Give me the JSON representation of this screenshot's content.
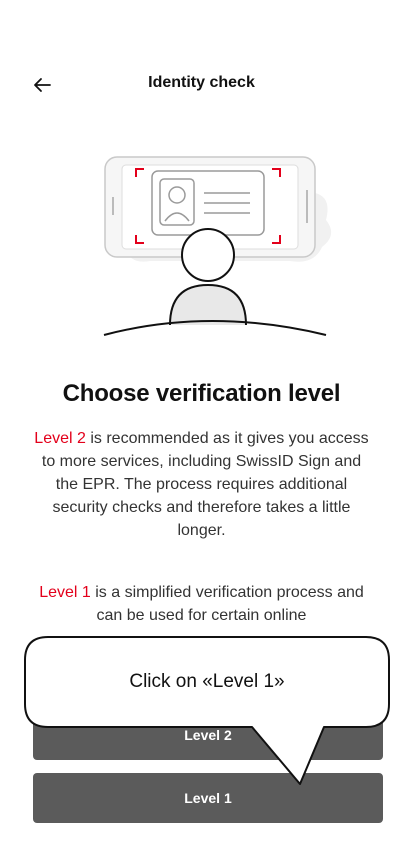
{
  "header": {
    "title": "Identity check",
    "back_icon": "arrow-left-icon"
  },
  "illustration": {
    "description_icon": "identity-verification-illustration",
    "accent_color": "#e3001b"
  },
  "content": {
    "heading": "Choose verification level",
    "level2_label": "Level 2",
    "level2_text": " is recommended as it gives you access to more services, including SwissID Sign and the EPR. The process requires additional security checks and therefore takes a little longer.",
    "level1_label": "Level 1",
    "level1_text": " is a simplified verification process and can be used for certain online"
  },
  "buttons": {
    "level2_label": "Level 2",
    "level1_label": "Level 1",
    "color": "#5b5b5b"
  },
  "callout": {
    "text": "Click on «Level 1»"
  }
}
